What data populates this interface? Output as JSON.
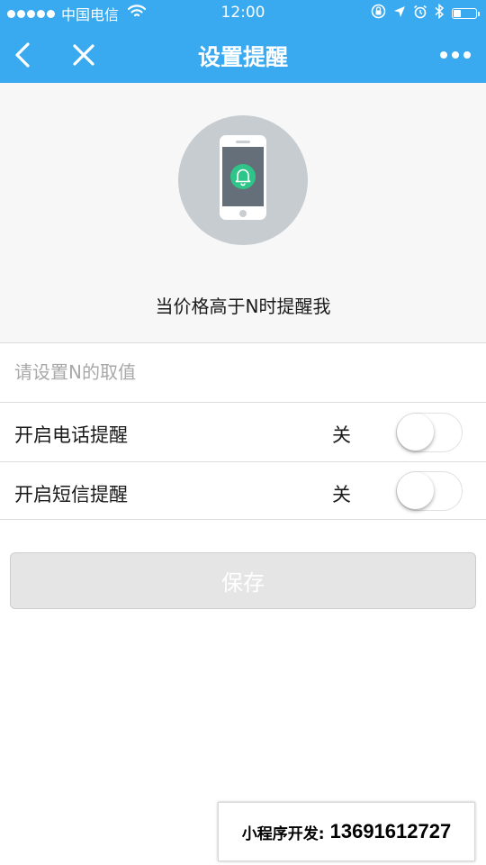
{
  "status_bar": {
    "carrier": "中国电信",
    "time": "12:00",
    "battery_level": 0.3
  },
  "nav": {
    "title": "设置提醒",
    "back_icon": "chevron-left-icon",
    "close_icon": "close-icon",
    "more_icon": "more-dots-icon"
  },
  "header": {
    "illustration_icon": "phone-bell-icon",
    "hint": "当价格高于N时提醒我"
  },
  "form": {
    "n_input": {
      "value": "",
      "placeholder": "请设置N的取值"
    },
    "phone_reminder": {
      "label": "开启电话提醒",
      "state_label": "关",
      "enabled": false
    },
    "sms_reminder": {
      "label": "开启短信提醒",
      "state_label": "关",
      "enabled": false
    }
  },
  "save_button": {
    "label": "保存",
    "disabled": true
  },
  "badge": {
    "label": "小程序开发:",
    "phone": "13691612727"
  },
  "colors": {
    "accent": "#39aaf0",
    "bell_green": "#2fc588",
    "phone_screen": "#646f7a"
  }
}
